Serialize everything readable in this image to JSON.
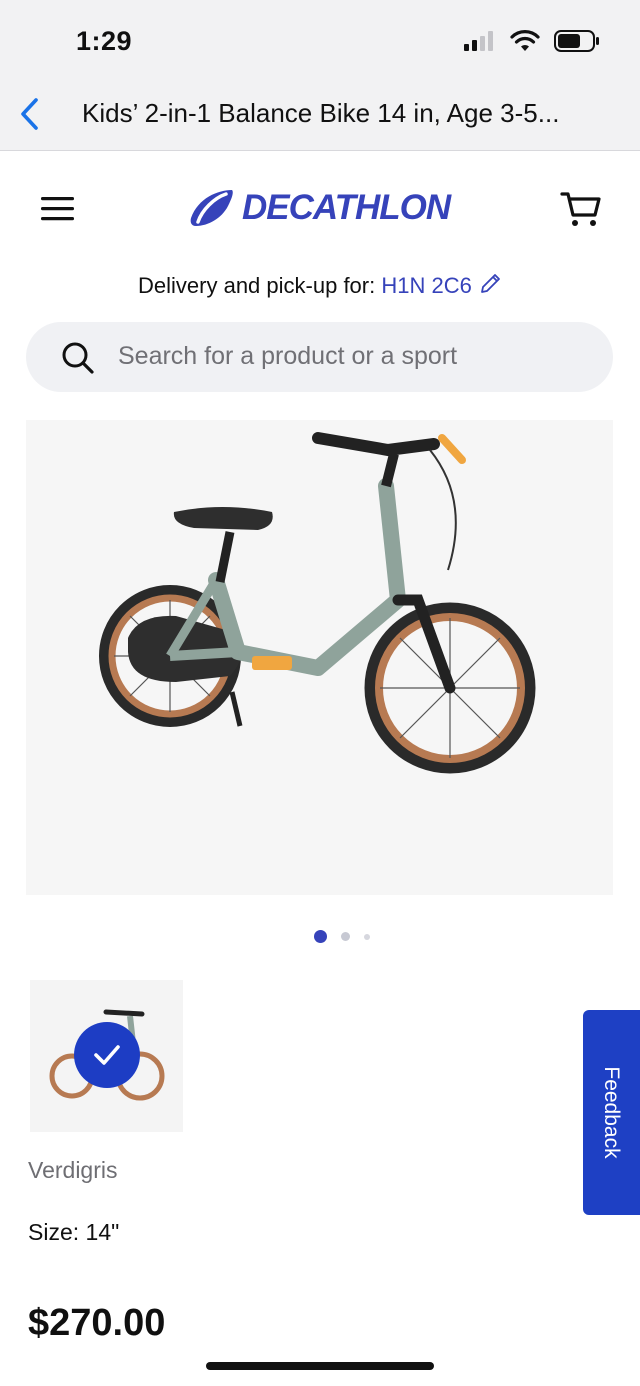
{
  "status_bar": {
    "time": "1:29",
    "icons": [
      "signal-icon",
      "wifi-icon",
      "battery-icon"
    ]
  },
  "nav": {
    "back_icon": "chevron-left-icon",
    "title": "Kids’ 2-in-1 Balance Bike 14 in, Age 3-5..."
  },
  "header": {
    "menu_icon": "hamburger-menu-icon",
    "logo_text": "DECATHLON",
    "cart_icon": "cart-icon"
  },
  "delivery": {
    "label": "Delivery and pick-up for:",
    "postal_code": "H1N 2C6",
    "edit_icon": "pencil-icon"
  },
  "search": {
    "placeholder": "Search for a product or a sport",
    "icon": "search-icon"
  },
  "gallery": {
    "image": "balance-bike-image",
    "pages": 3,
    "current_page": 1
  },
  "variant": {
    "color_name": "Verdigris",
    "selected": true,
    "size_label": "Size: 14\""
  },
  "price": "$270.00",
  "feedback": {
    "label": "Feedback"
  },
  "colors": {
    "brand": "#3643ba",
    "feedback_bg": "#1e40c4",
    "frame": "#8fa39b",
    "tire": "#b77a52"
  }
}
